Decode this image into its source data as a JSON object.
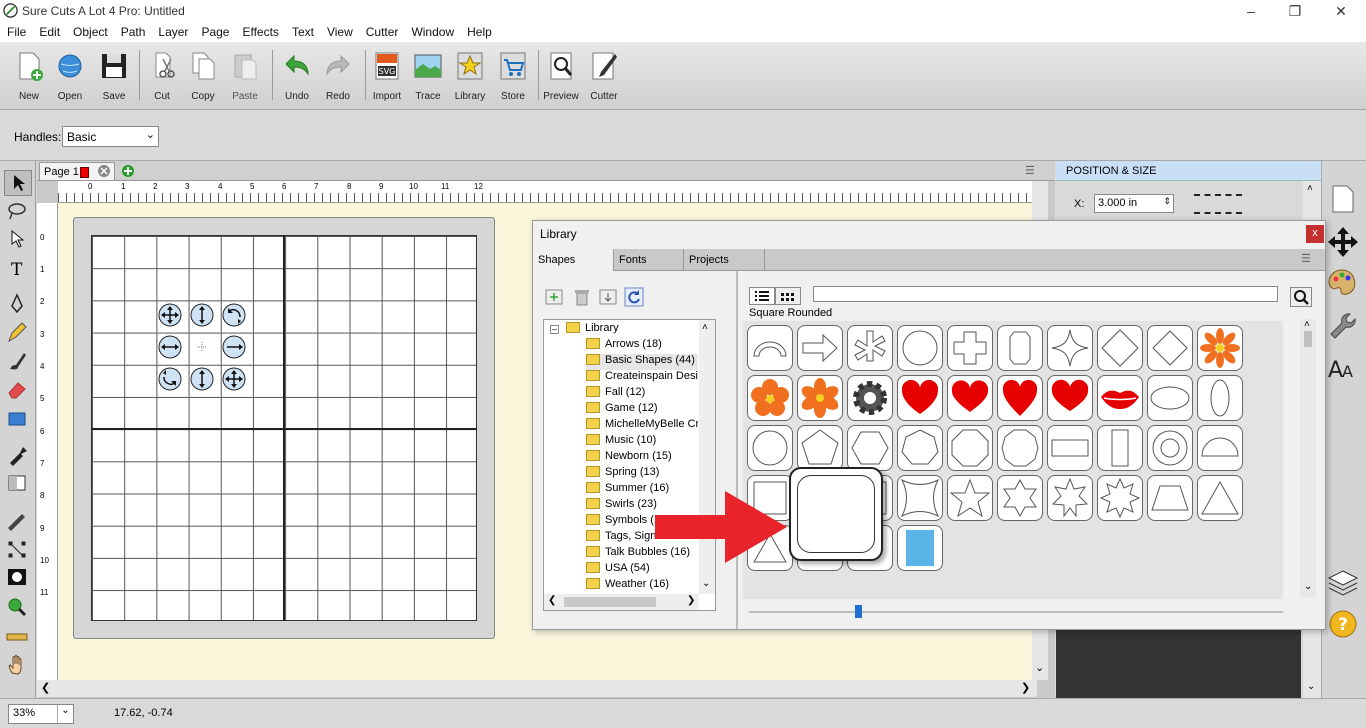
{
  "window": {
    "title": "Sure Cuts A Lot 4 Pro: Untitled"
  },
  "menu": [
    "File",
    "Edit",
    "Object",
    "Path",
    "Layer",
    "Page",
    "Effects",
    "Text",
    "View",
    "Cutter",
    "Window",
    "Help"
  ],
  "toolbar": [
    {
      "label": "New",
      "icon": "new-document-icon"
    },
    {
      "label": "Open",
      "icon": "open-globe-icon"
    },
    {
      "label": "Save",
      "icon": "save-disk-icon"
    },
    {
      "label": "Cut",
      "icon": "scissors-icon"
    },
    {
      "label": "Copy",
      "icon": "copy-icon"
    },
    {
      "label": "Paste",
      "icon": "paste-icon"
    },
    {
      "label": "Undo",
      "icon": "undo-arrow-icon"
    },
    {
      "label": "Redo",
      "icon": "redo-arrow-icon"
    },
    {
      "label": "Import",
      "icon": "svg-import-icon"
    },
    {
      "label": "Trace",
      "icon": "trace-picture-icon"
    },
    {
      "label": "Library",
      "icon": "library-star-icon"
    },
    {
      "label": "Store",
      "icon": "store-cart-icon"
    },
    {
      "label": "Preview",
      "icon": "preview-magnifier-icon"
    },
    {
      "label": "Cutter",
      "icon": "cutter-knife-icon"
    }
  ],
  "options": {
    "handles_label": "Handles:",
    "handles_value": "Basic"
  },
  "page_tab": {
    "label": "Page 1"
  },
  "ruler_h": [
    "0",
    "1",
    "2",
    "3",
    "4",
    "5",
    "6",
    "7",
    "8",
    "9",
    "10",
    "11",
    "12"
  ],
  "ruler_v": [
    "0",
    "1",
    "2",
    "3",
    "4",
    "5",
    "6",
    "7",
    "8",
    "9",
    "10",
    "11"
  ],
  "right_panel": {
    "title": "POSITION & SIZE",
    "x_label": "X:",
    "x_value": "3.000 in"
  },
  "library": {
    "title": "Library",
    "tabs": [
      "Shapes",
      "Fonts",
      "Projects"
    ],
    "category_label": "Square Rounded",
    "search_placeholder": "",
    "tree_root": "Library",
    "folders": [
      "Arrows (18)",
      "Basic Shapes (44)",
      "Createinspain Desi",
      "Fall (12)",
      "Game (12)",
      "MichelleMyBelle Cre",
      "Music (10)",
      "Newborn (15)",
      "Spring (13)",
      "Summer (16)",
      "Swirls (23)",
      "Symbols (11)",
      "Tags, Signs & Bann",
      "Talk Bubbles (16)",
      "USA (54)",
      "Weather (16)"
    ]
  },
  "status": {
    "zoom": "33%",
    "coords": "17.62, -0.74"
  },
  "colors": {
    "accent_red": "#e8232a",
    "heart_red": "#e60000",
    "flower_orange": "#f07020",
    "tile_blue": "#5ab4e8"
  }
}
